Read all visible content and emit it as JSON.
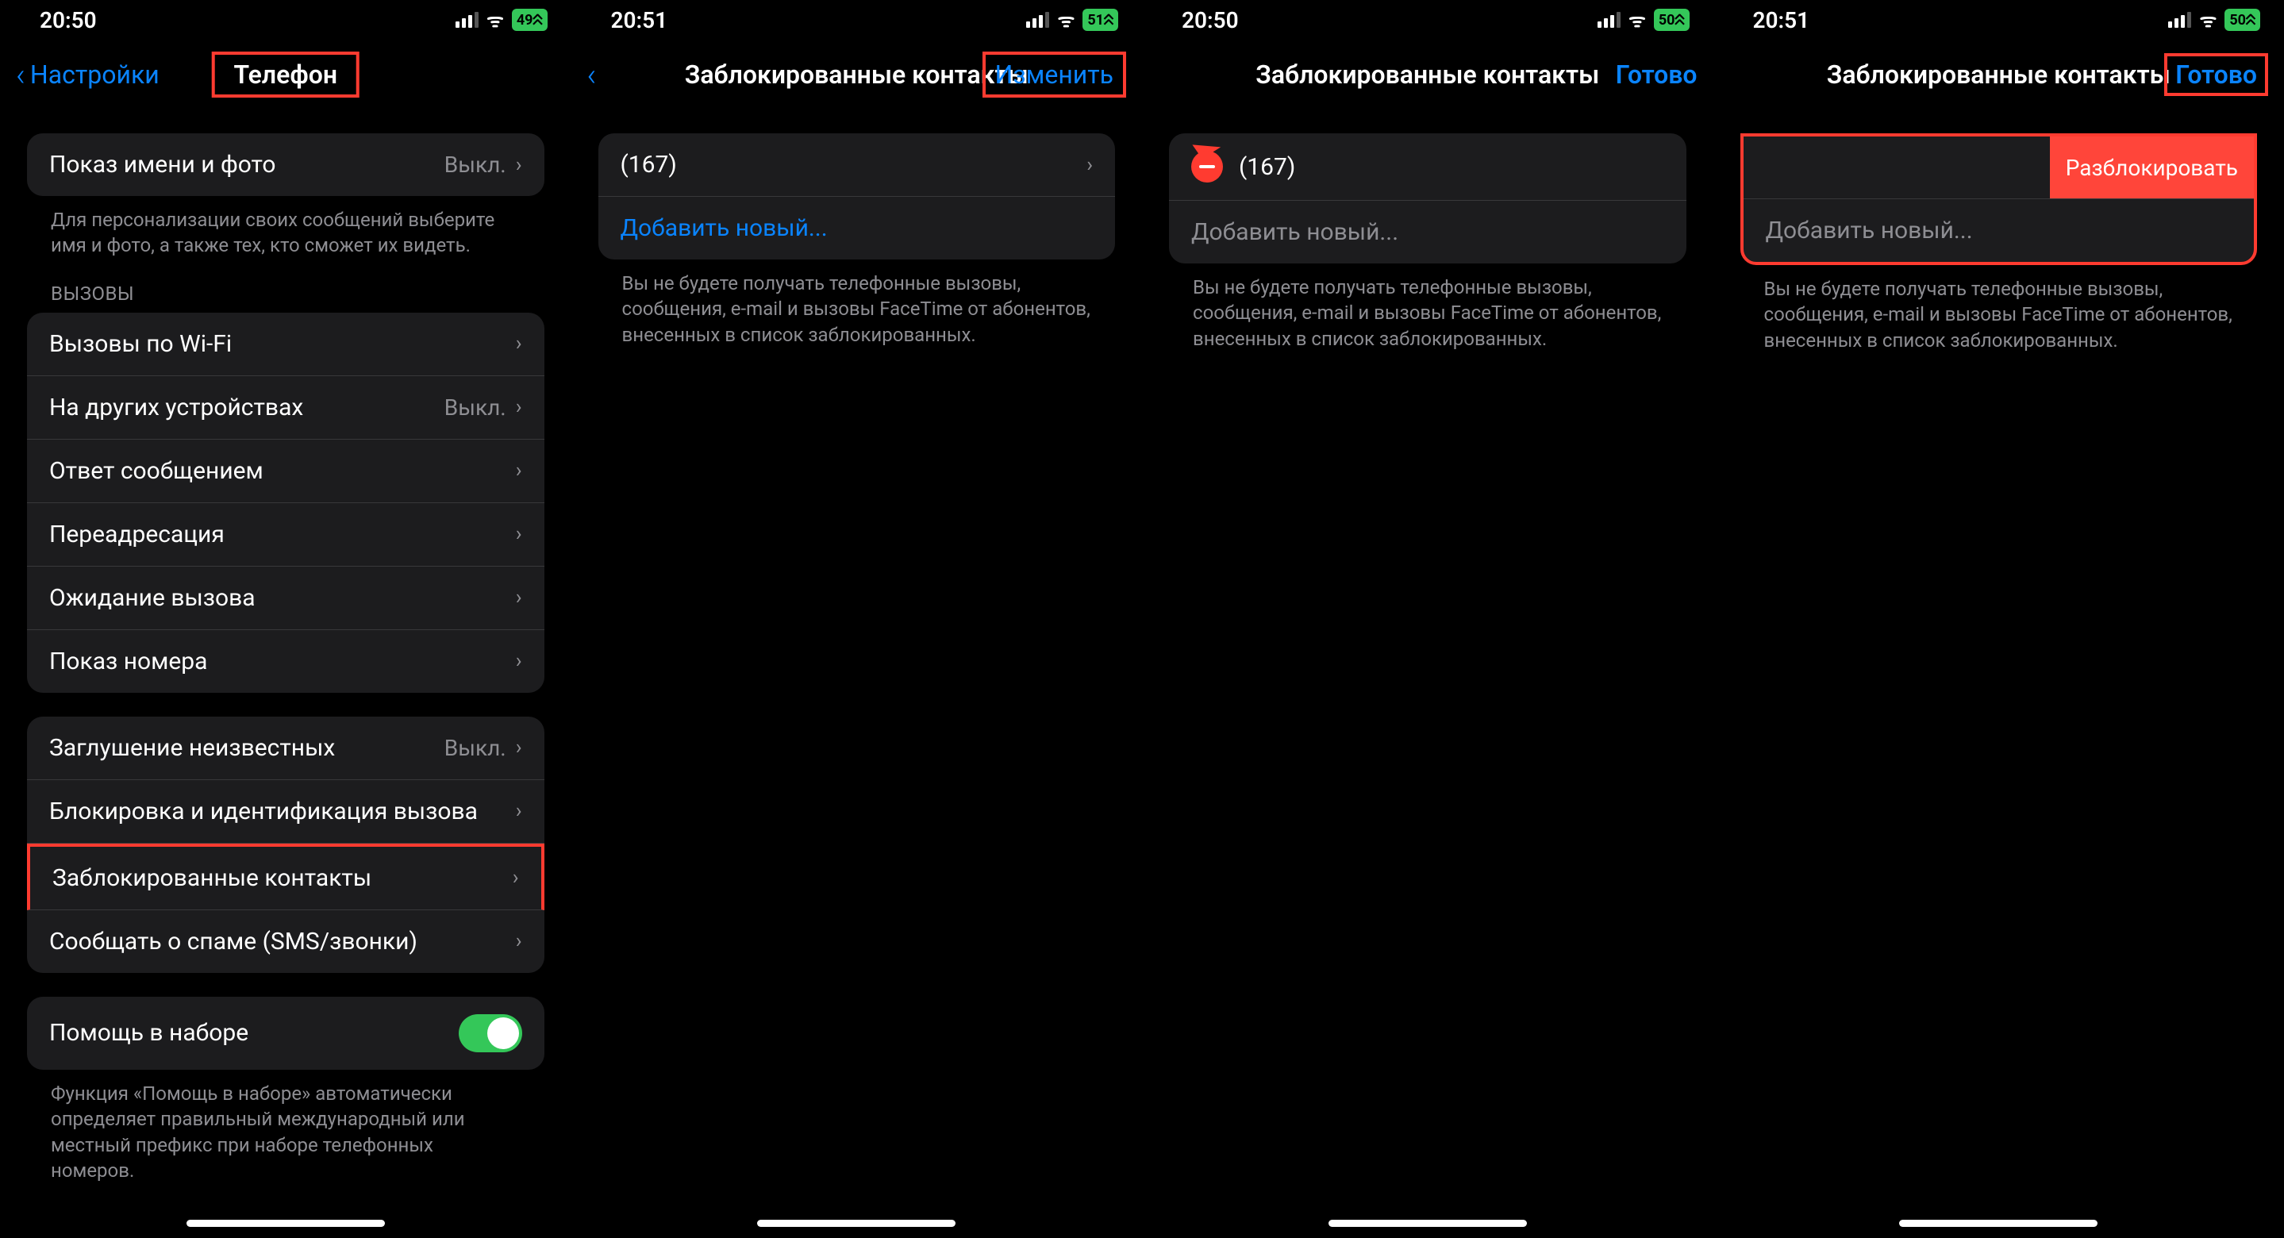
{
  "screens": [
    {
      "time": "20:50",
      "battery": "49",
      "nav": {
        "back": "Настройки",
        "title": "Телефон"
      },
      "group1": {
        "row1": {
          "label": "Показ имени и фото",
          "value": "Выкл."
        },
        "footer": "Для персонализации своих сообщений выберите имя и фото, а также тех, кто сможет их видеть."
      },
      "calls_header": "ВЫЗОВЫ",
      "group2": [
        {
          "label": "Вызовы по Wi-Fi"
        },
        {
          "label": "На других устройствах",
          "value": "Выкл."
        },
        {
          "label": "Ответ сообщением"
        },
        {
          "label": "Переадресация"
        },
        {
          "label": "Ожидание вызова"
        },
        {
          "label": "Показ номера"
        }
      ],
      "group3": [
        {
          "label": "Заглушение неизвестных",
          "value": "Выкл."
        },
        {
          "label": "Блокировка и идентификация вызова"
        },
        {
          "label": "Заблокированные контакты"
        },
        {
          "label": "Сообщать о спаме (SMS/звонки)"
        }
      ],
      "group4": {
        "label": "Помощь в наборе",
        "footer": "Функция «Помощь в наборе» автоматически определяет правильный международный или местный префикс при наборе телефонных номеров."
      }
    },
    {
      "time": "20:51",
      "battery": "51",
      "nav": {
        "title": "Заблокированные контакты",
        "action": "Изменить"
      },
      "list": {
        "contact": "(167)",
        "add": "Добавить новый..."
      },
      "footer": "Вы не будете получать телефонные вызовы, сообщения, e-mail и вызовы FaceTime от абонентов, внесенных в список заблокированных."
    },
    {
      "time": "20:50",
      "battery": "50",
      "nav": {
        "title": "Заблокированные контакты",
        "action": "Готово"
      },
      "list": {
        "contact": "(167)",
        "add": "Добавить новый..."
      },
      "footer": "Вы не будете получать телефонные вызовы, сообщения, e-mail и вызовы FaceTime от абонентов, внесенных в список заблокированных."
    },
    {
      "time": "20:51",
      "battery": "50",
      "nav": {
        "title": "Заблокированные контакты",
        "action": "Готово"
      },
      "list": {
        "unblock": "Разблокировать",
        "add": "Добавить новый..."
      },
      "footer": "Вы не будете получать телефонные вызовы, сообщения, e-mail и вызовы FaceTime от абонентов, внесенных в список заблокированных."
    }
  ]
}
